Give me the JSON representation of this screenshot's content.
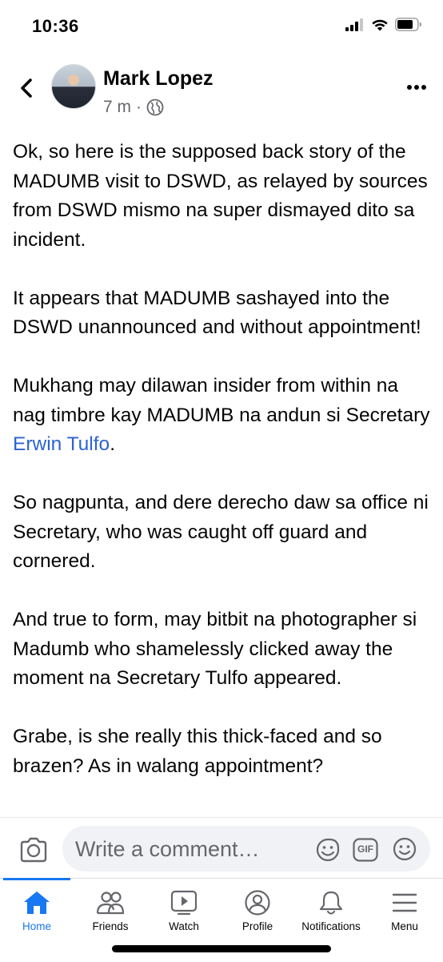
{
  "status_bar": {
    "time": "10:36",
    "icons": [
      "cellular-signal-icon",
      "wifi-icon",
      "battery-icon"
    ]
  },
  "post": {
    "author": "Mark Lopez",
    "time_ago": "7 m",
    "separator": "·",
    "audience_icon": "globe-icon",
    "paragraphs": {
      "p1": "Ok, so here is the supposed back story of the MADUMB visit to DSWD, as relayed by sources from DSWD mismo na super dismayed dito sa incident.",
      "p2": "It appears that MADUMB sashayed into the DSWD unannounced and without appointment!",
      "p3_before": "Mukhang may dilawan insider from within na nag timbre kay MADUMB na andun si Secretary ",
      "p3_link": "Erwin Tulfo",
      "p3_after": ".",
      "p4": "So nagpunta, and dere derecho daw sa office ni Secretary, who was caught off guard and cornered.",
      "p5": "And true to form, may bitbit na photographer si Madumb who shamelessly clicked away the moment na Secretary Tulfo appeared.",
      "p6": "Grabe, is she really this thick-faced and so brazen? As in walang appointment?"
    },
    "link_color": "#2d63d2"
  },
  "comment_bar": {
    "placeholder": "Write a comment…",
    "gif_label": "GIF"
  },
  "tab_bar": {
    "accent_color": "#1877f2",
    "tabs": [
      {
        "label": "Home",
        "icon": "home-icon",
        "active": true
      },
      {
        "label": "Friends",
        "icon": "friends-icon",
        "active": false
      },
      {
        "label": "Watch",
        "icon": "watch-icon",
        "active": false
      },
      {
        "label": "Profile",
        "icon": "profile-icon",
        "active": false
      },
      {
        "label": "Notifications",
        "icon": "bell-icon",
        "active": false
      },
      {
        "label": "Menu",
        "icon": "menu-icon",
        "active": false
      }
    ]
  }
}
